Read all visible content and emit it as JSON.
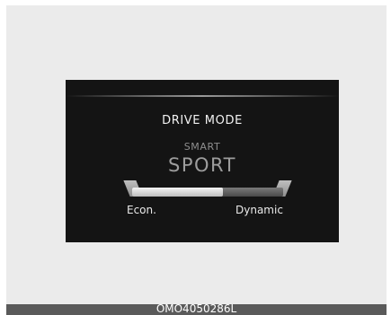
{
  "display": {
    "title": "DRIVE MODE",
    "mode_group": "SMART",
    "mode_value": "SPORT",
    "selector": {
      "left_label": "Econ.",
      "right_label": "Dynamic",
      "level": 0.6
    }
  },
  "caption": "OMO4050286L",
  "colors": {
    "screen_background": "#141414",
    "panel_background": "#ebebeb",
    "caption_bar": "#5a5a5a"
  }
}
